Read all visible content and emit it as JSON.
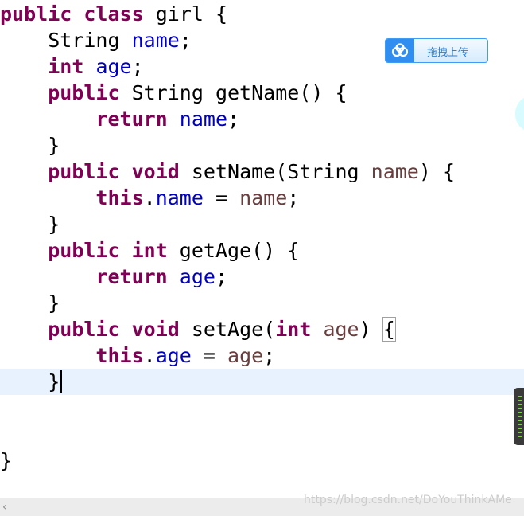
{
  "code": {
    "class_decl": {
      "kw1": "public",
      "kw2": "class",
      "rest": " girl {"
    },
    "field_name": {
      "type": "String",
      "name": "name",
      "semi": ";"
    },
    "field_age": {
      "type": "int",
      "name": "age",
      "semi": ";"
    },
    "getname_sig": {
      "kw1": "public",
      "rest": " String getName() {"
    },
    "getname_body": {
      "kw": "return",
      "field": "name",
      "semi": ";"
    },
    "close_brace": "}",
    "setname_sig": {
      "kw1": "public",
      "kw2": "void",
      "rest": " setName(String ",
      "param": "name",
      "end": ") {"
    },
    "setname_body": {
      "kw": "this",
      "dot": ".",
      "field": "name",
      "eq": " = ",
      "param": "name",
      "semi": ";"
    },
    "getage_sig": {
      "kw1": "public",
      "kw2": "int",
      "rest": " getAge() {"
    },
    "getage_body": {
      "kw": "return",
      "field": "age",
      "semi": ";"
    },
    "setage_sig": {
      "kw1": "public",
      "kw2": "void",
      "rest": " setAge(",
      "kw3": "int",
      "param": "age",
      "close_paren": ")",
      "open_brace": "{"
    },
    "setage_body": {
      "kw": "this",
      "dot": ".",
      "field": "age",
      "eq": " = ",
      "param": "age",
      "semi": ";"
    },
    "class_close": "}"
  },
  "upload_button": {
    "label": "拖拽上传",
    "icon": "cloud-icon"
  },
  "watermark": "https://blog.csdn.net/DoYouThinkAMe",
  "scrollbar": {
    "left_arrow": "‹"
  },
  "colors": {
    "keyword": "#7f0055",
    "field": "#0000c0",
    "parameter": "#6a3e3e",
    "current_line": "#e8f2fe"
  }
}
